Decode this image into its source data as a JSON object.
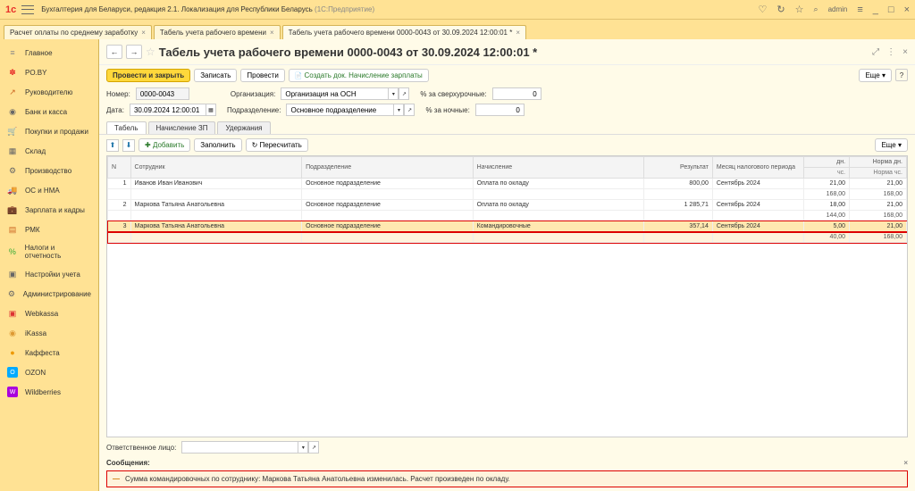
{
  "app": {
    "title": "Бухгалтерия для Беларуси, редакция 2.1. Локализация для Республики Беларусь",
    "subtitle": "(1С:Предприятие)",
    "user": "admin"
  },
  "tabs": {
    "t0": "Расчет оплаты по среднему заработку",
    "t1": "Табель учета рабочего времени",
    "t2": "Табель учета рабочего времени 0000-0043 от 30.09.2024 12:00:01 *"
  },
  "sidebar": {
    "main": "Главное",
    "poby": "PO.BY",
    "manager": "Руководителю",
    "bank": "Банк и касса",
    "sales": "Покупки и продажи",
    "warehouse": "Склад",
    "production": "Производство",
    "os": "ОС и НМА",
    "salary": "Зарплата и кадры",
    "rmk": "РМК",
    "taxes": "Налоги и отчетность",
    "settings": "Настройки учета",
    "admin": "Администрирование",
    "webkassa": "Webkassa",
    "ikassa": "iKassa",
    "kaffesta": "Каффеста",
    "ozon": "OZON",
    "wildberries": "Wildberries"
  },
  "page": {
    "title": "Табель учета рабочего времени 0000-0043 от 30.09.2024 12:00:01 *"
  },
  "toolbar": {
    "save_close": "Провести и закрыть",
    "write": "Записать",
    "post": "Провести",
    "create_calc": "Создать док. Начисление зарплаты",
    "more": "Еще"
  },
  "form": {
    "number_lbl": "Номер:",
    "number": "0000-0043",
    "org_lbl": "Организация:",
    "org": "Организация на ОСН",
    "overtime_lbl": "% за сверхурочные:",
    "overtime": "0",
    "date_lbl": "Дата:",
    "date": "30.09.2024 12:00:01",
    "dept_lbl": "Подразделение:",
    "dept": "Основное подразделение",
    "night_lbl": "% за ночные:",
    "night": "0"
  },
  "subtabs": {
    "t0": "Табель",
    "t1": "Начисление ЗП",
    "t2": "Удержания"
  },
  "table_toolbar": {
    "add": "Добавить",
    "fill": "Заполнить",
    "recalc": "Пересчитать",
    "more": "Еще"
  },
  "columns": {
    "n": "N",
    "emp": "Сотрудник",
    "dept": "Подразделение",
    "acc": "Начисление",
    "result": "Результат",
    "period": "Месяц налогового периода",
    "days": "дн.",
    "norm_days": "Норма дн.",
    "hours": "чс.",
    "norm_hours": "Норма чс."
  },
  "rows": [
    {
      "n": "1",
      "emp": "Иванов Иван Иванович",
      "dept": "Основное подразделение",
      "acc": "Оплата по окладу",
      "result": "800,00",
      "period": "Сентябрь 2024",
      "days": "21,00",
      "norm_days": "21,00",
      "hours": "168,00",
      "norm_hours": "168,00",
      "hl": false
    },
    {
      "n": "2",
      "emp": "Маркова Татьяна Анатольевна",
      "dept": "Основное подразделение",
      "acc": "Оплата по окладу",
      "result": "1 285,71",
      "period": "Сентябрь 2024",
      "days": "18,00",
      "norm_days": "21,00",
      "hours": "144,00",
      "norm_hours": "168,00",
      "hl": false
    },
    {
      "n": "3",
      "emp": "Маркова Татьяна Анатольевна",
      "dept": "Основное подразделение",
      "acc": "Командировочные",
      "result": "357,14",
      "period": "Сентябрь 2024",
      "days": "5,00",
      "norm_days": "21,00",
      "hours": "40,00",
      "norm_hours": "168,00",
      "hl": true
    }
  ],
  "bottom": {
    "resp_lbl": "Ответственное лицо:"
  },
  "messages": {
    "label": "Сообщения:",
    "text": "Сумма командировочных по сотруднику: Маркова Татьяна Анатольевна изменилась. Расчет произведен по окладу."
  }
}
